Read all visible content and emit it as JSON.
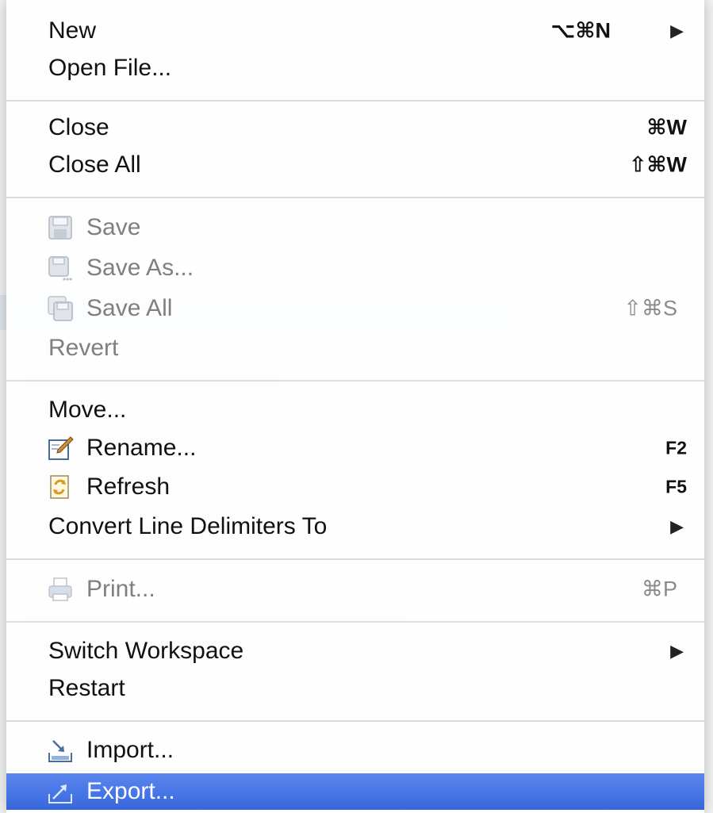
{
  "menu": {
    "items": [
      {
        "label": "New",
        "shortcut": "⌥⌘N",
        "submenu": true
      },
      {
        "label": "Open File..."
      },
      {
        "label": "Close",
        "shortcut": "⌘W"
      },
      {
        "label": "Close All",
        "shortcut": "⇧⌘W"
      },
      {
        "label": "Save",
        "icon": "save-icon",
        "disabled": true
      },
      {
        "label": "Save As...",
        "icon": "save-as-icon",
        "disabled": true
      },
      {
        "label": "Save All",
        "icon": "save-all-icon",
        "shortcut": "⇧⌘S",
        "disabled": true
      },
      {
        "label": "Revert",
        "disabled": true
      },
      {
        "label": "Move..."
      },
      {
        "label": "Rename...",
        "icon": "rename-icon",
        "shortcut": "F2"
      },
      {
        "label": "Refresh",
        "icon": "refresh-icon",
        "shortcut": "F5"
      },
      {
        "label": "Convert Line Delimiters To",
        "submenu": true
      },
      {
        "label": "Print...",
        "icon": "print-icon",
        "shortcut": "⌘P",
        "disabled": true
      },
      {
        "label": "Switch Workspace",
        "submenu": true
      },
      {
        "label": "Restart"
      },
      {
        "label": "Import...",
        "icon": "import-icon"
      },
      {
        "label": "Export...",
        "icon": "export-icon",
        "selected": true
      }
    ],
    "submenu_arrow": "▶"
  },
  "colors": {
    "selection": "#3d6fe0",
    "disabled_text": "#7f7f7f",
    "separator": "#dcdcdc"
  }
}
